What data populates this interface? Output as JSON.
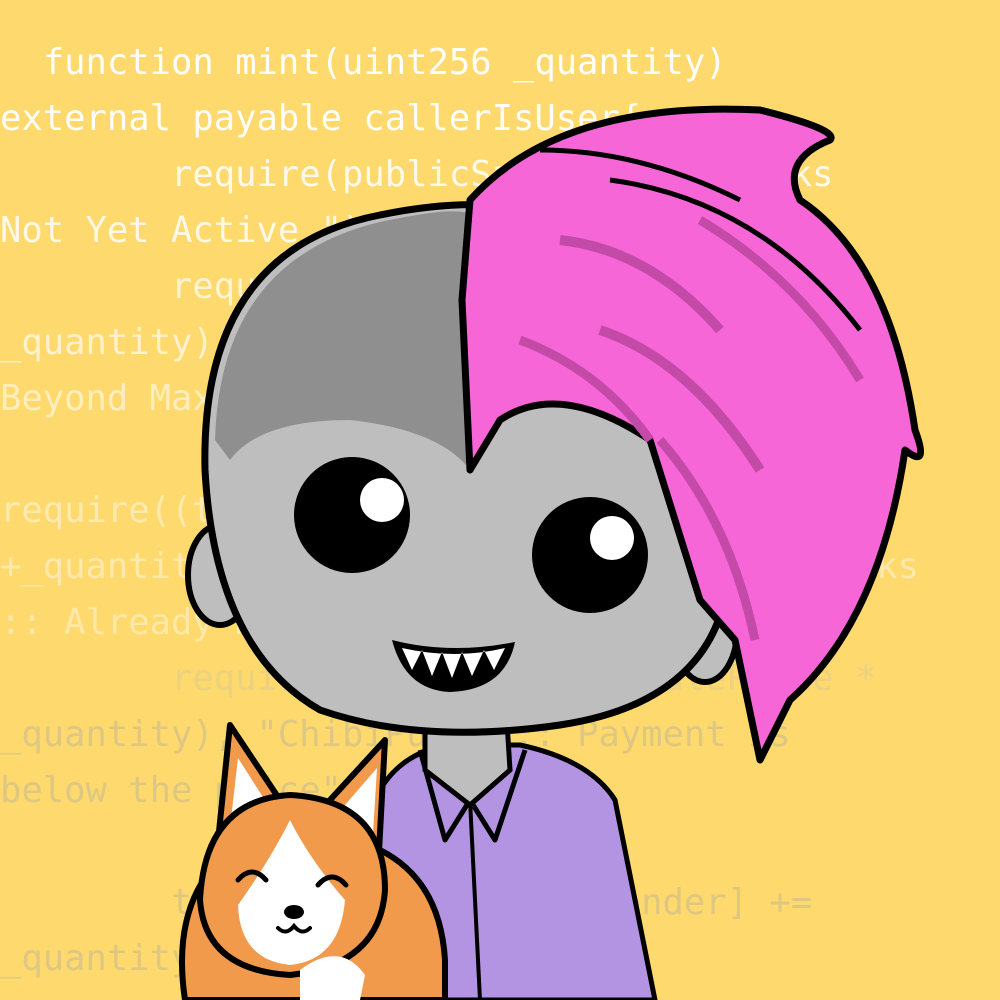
{
  "code_lines": [
    "  function mint(uint256 _quantity)",
    "external payable callerIsUser{",
    "        require(publicSale, \"ChibiPunks",
    "Not Yet Active.\");",
    "        require((totalSupply() +",
    "_quantity) <= MAX_SUPPLY, \"ChibiPunks :",
    "Beyond Max Supply\");",
    "",
    "require((totalPublicMint[msg.sender]",
    "+_quantity) <= MAX_PUBLIC_MINT, \"ChibiPunks",
    ":: Already minted 3 times!\");",
    "        require(msg.value >= (SalePrice *",
    "_quantity), \"ChibiPunks :: Payment is",
    "below the price\");",
    "",
    "        totalPublicMint[msg.sender] +=",
    "_quantity;"
  ],
  "colors": {
    "background": "#FDD96E",
    "hair": "#F766D7",
    "skin": "#BEBEBE",
    "shirt": "#B294E2",
    "corgi": "#F19A4B",
    "text": "#FFFFFF"
  }
}
